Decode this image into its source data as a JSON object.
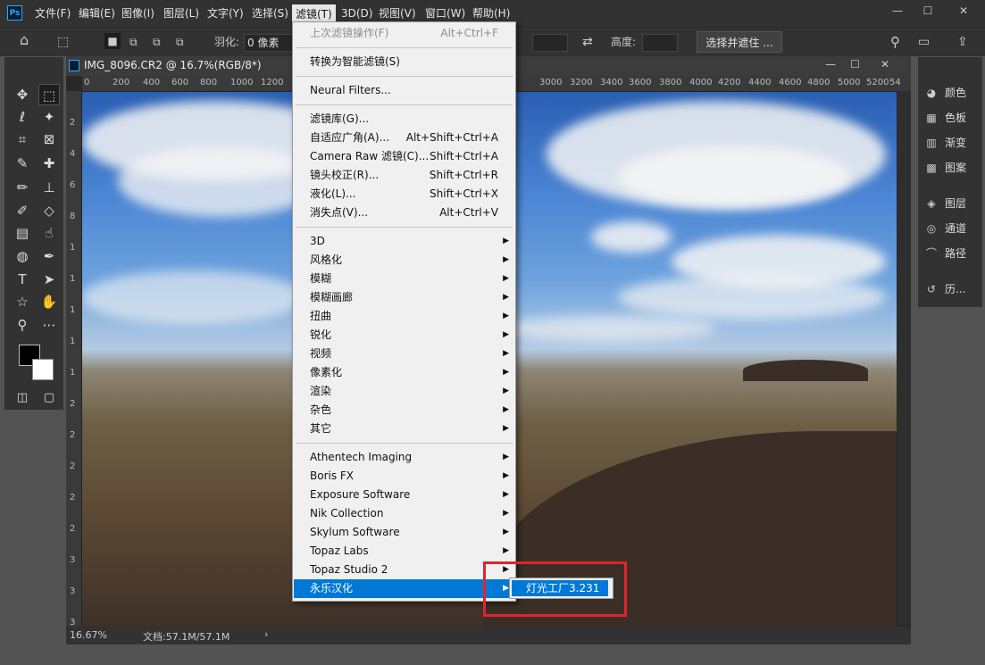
{
  "menubar": {
    "items": [
      "文件(F)",
      "编辑(E)",
      "图像(I)",
      "图层(L)",
      "文字(Y)",
      "选择(S)",
      "滤镜(T)",
      "3D(D)",
      "视图(V)",
      "窗口(W)",
      "帮助(H)"
    ],
    "active_index": 6,
    "logo": "Ps"
  },
  "window_controls": {
    "minimize": "—",
    "maximize": "☐",
    "close": "✕"
  },
  "options": {
    "feather_label": "羽化:",
    "feather_value": "0 像素",
    "height_label": "高度:",
    "select_mask_button": "选择并遮住 ...",
    "accent": "#31a8ff"
  },
  "document": {
    "title": "IMG_8096.CR2 @ 16.7%(RGB/8*)",
    "ruler_h": [
      "0",
      "200",
      "400",
      "600",
      "800",
      "1000",
      "1200",
      "3000",
      "3200",
      "3400",
      "3600",
      "3800",
      "4000",
      "4200",
      "4400",
      "4600",
      "4800",
      "5000",
      "5200",
      "54"
    ],
    "ruler_v": [
      "2",
      "4",
      "6",
      "8",
      "1",
      "1",
      "1",
      "1",
      "1",
      "2",
      "2",
      "2",
      "2",
      "2",
      "3",
      "3",
      "3"
    ],
    "zoom": "16.67%",
    "doc_size": "文档:57.1M/57.1M"
  },
  "right_panel": {
    "items": [
      {
        "icon": "palette-icon",
        "label": "颜色"
      },
      {
        "icon": "swatches-icon",
        "label": "色板"
      },
      {
        "icon": "gradient-icon",
        "label": "渐变"
      },
      {
        "icon": "patterns-icon",
        "label": "图案"
      },
      {
        "icon": "layers-icon",
        "label": "图层"
      },
      {
        "icon": "channels-icon",
        "label": "通道"
      },
      {
        "icon": "paths-icon",
        "label": "路径"
      },
      {
        "icon": "history-icon",
        "label": "历..."
      }
    ]
  },
  "filter_menu": {
    "items": [
      {
        "label": "上次滤镜操作(F)",
        "shortcut": "Alt+Ctrl+F",
        "disabled": true
      },
      {
        "sep": true
      },
      {
        "label": "转换为智能滤镜(S)"
      },
      {
        "sep": true
      },
      {
        "label": "Neural Filters..."
      },
      {
        "sep": true
      },
      {
        "label": "滤镜库(G)..."
      },
      {
        "label": "自适应广角(A)...",
        "shortcut": "Alt+Shift+Ctrl+A"
      },
      {
        "label": "Camera Raw 滤镜(C)...",
        "shortcut": "Shift+Ctrl+A"
      },
      {
        "label": "镜头校正(R)...",
        "shortcut": "Shift+Ctrl+R"
      },
      {
        "label": "液化(L)...",
        "shortcut": "Shift+Ctrl+X"
      },
      {
        "label": "消失点(V)...",
        "shortcut": "Alt+Ctrl+V"
      },
      {
        "sep": true
      },
      {
        "label": "3D",
        "sub": true
      },
      {
        "label": "风格化",
        "sub": true
      },
      {
        "label": "模糊",
        "sub": true
      },
      {
        "label": "模糊画廊",
        "sub": true
      },
      {
        "label": "扭曲",
        "sub": true
      },
      {
        "label": "锐化",
        "sub": true
      },
      {
        "label": "视频",
        "sub": true
      },
      {
        "label": "像素化",
        "sub": true
      },
      {
        "label": "渲染",
        "sub": true
      },
      {
        "label": "杂色",
        "sub": true
      },
      {
        "label": "其它",
        "sub": true
      },
      {
        "sep": true
      },
      {
        "label": "Athentech Imaging",
        "sub": true
      },
      {
        "label": "Boris FX",
        "sub": true
      },
      {
        "label": "Exposure Software",
        "sub": true
      },
      {
        "label": "Nik Collection",
        "sub": true
      },
      {
        "label": "Skylum Software",
        "sub": true
      },
      {
        "label": "Topaz Labs",
        "sub": true
      },
      {
        "label": "Topaz Studio 2",
        "sub": true
      },
      {
        "label": "永乐汉化",
        "sub": true,
        "highlight": true
      }
    ],
    "submenu_item": "灯光工厂3.231",
    "highlight_color": "#0078d7",
    "annotation_color": "#e0242e"
  }
}
